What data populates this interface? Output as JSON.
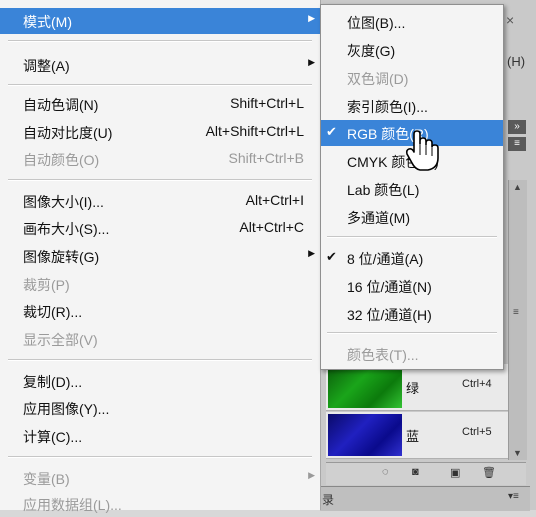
{
  "main_menu": {
    "items": [
      {
        "label": "模式(M)",
        "shortcut": "",
        "submenu": true,
        "state": "highlight"
      },
      {
        "label": "调整(A)",
        "shortcut": "",
        "submenu": true,
        "state": "normal"
      },
      {
        "label": "自动色调(N)",
        "shortcut": "Shift+Ctrl+L",
        "submenu": false,
        "state": "normal"
      },
      {
        "label": "自动对比度(U)",
        "shortcut": "Alt+Shift+Ctrl+L",
        "submenu": false,
        "state": "normal"
      },
      {
        "label": "自动颜色(O)",
        "shortcut": "Shift+Ctrl+B",
        "submenu": false,
        "state": "disabled"
      },
      {
        "label": "图像大小(I)...",
        "shortcut": "Alt+Ctrl+I",
        "submenu": false,
        "state": "normal"
      },
      {
        "label": "画布大小(S)...",
        "shortcut": "Alt+Ctrl+C",
        "submenu": false,
        "state": "normal"
      },
      {
        "label": "图像旋转(G)",
        "shortcut": "",
        "submenu": true,
        "state": "normal"
      },
      {
        "label": "裁剪(P)",
        "shortcut": "",
        "submenu": false,
        "state": "disabled"
      },
      {
        "label": "裁切(R)...",
        "shortcut": "",
        "submenu": false,
        "state": "normal"
      },
      {
        "label": "显示全部(V)",
        "shortcut": "",
        "submenu": false,
        "state": "disabled"
      },
      {
        "label": "复制(D)...",
        "shortcut": "",
        "submenu": false,
        "state": "normal"
      },
      {
        "label": "应用图像(Y)...",
        "shortcut": "",
        "submenu": false,
        "state": "normal"
      },
      {
        "label": "计算(C)...",
        "shortcut": "",
        "submenu": false,
        "state": "normal"
      },
      {
        "label": "变量(B)",
        "shortcut": "",
        "submenu": true,
        "state": "disabled"
      },
      {
        "label": "应用数据组(L)...",
        "shortcut": "",
        "submenu": false,
        "state": "disabled"
      }
    ]
  },
  "mode_submenu": {
    "items": [
      {
        "label": "位图(B)...",
        "checked": false,
        "state": "normal"
      },
      {
        "label": "灰度(G)",
        "checked": false,
        "state": "normal"
      },
      {
        "label": "双色调(D)",
        "checked": false,
        "state": "disabled"
      },
      {
        "label": "索引颜色(I)...",
        "checked": false,
        "state": "normal"
      },
      {
        "label": "RGB 颜色(R)",
        "checked": true,
        "state": "highlight"
      },
      {
        "label": "CMYK 颜色(C)",
        "checked": false,
        "state": "normal"
      },
      {
        "label": "Lab 颜色(L)",
        "checked": false,
        "state": "normal"
      },
      {
        "label": "多通道(M)",
        "checked": false,
        "state": "normal"
      },
      {
        "label": "8 位/通道(A)",
        "checked": true,
        "state": "normal"
      },
      {
        "label": "16 位/通道(N)",
        "checked": false,
        "state": "normal"
      },
      {
        "label": "32 位/通道(H)",
        "checked": false,
        "state": "normal"
      },
      {
        "label": "颜色表(T)...",
        "checked": false,
        "state": "disabled"
      }
    ]
  },
  "channels_panel": {
    "close": "×",
    "menu_fragment": "(H)",
    "rows": [
      {
        "name": "绿",
        "shortcut": "Ctrl+4"
      },
      {
        "name": "蓝",
        "shortcut": "Ctrl+5"
      }
    ],
    "status_fragment": "录"
  },
  "colors": {
    "highlight": "#3a84d8",
    "menu_bg": "#f4f4f4",
    "disabled_text": "#9a9a9a"
  }
}
